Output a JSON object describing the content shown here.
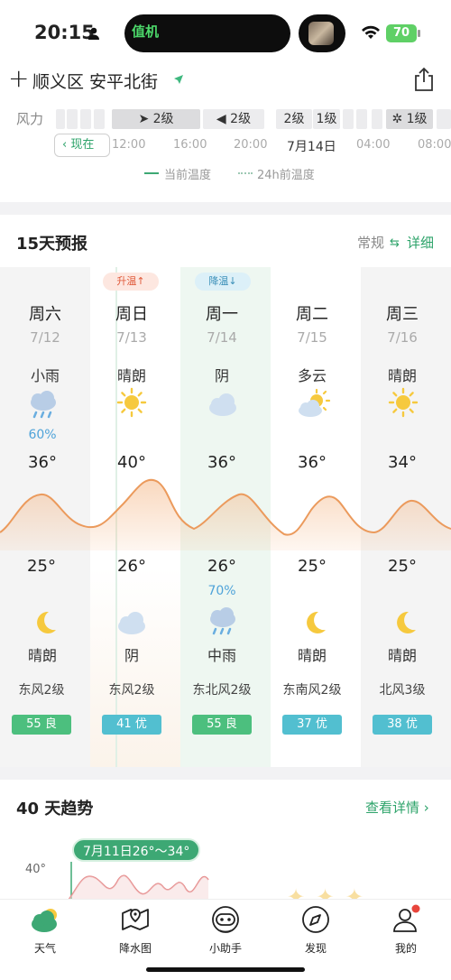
{
  "status_bar": {
    "time": "20:15",
    "island_app_text": "值机",
    "battery": "70"
  },
  "header": {
    "location": "顺义区 安平北街",
    "add_icon": "plus-icon",
    "share_icon": "share-icon"
  },
  "hourly": {
    "wind_label": "风力",
    "wind_cells": [
      "2级",
      "2级",
      "2级",
      "1级",
      "1级"
    ],
    "now_label": "现在",
    "hours": [
      "12:00",
      "16:00",
      "20:00",
      "7月14日",
      "04:00",
      "08:00"
    ],
    "legend_current": "当前温度",
    "legend_24h": "24h前温度"
  },
  "forecast15": {
    "title": "15天预报",
    "mode_normal": "常规",
    "mode_detail": "详细",
    "tag_up": "升温",
    "tag_down": "降温",
    "days": [
      {
        "weekday": "周六",
        "date": "7/12",
        "day_cond": "小雨",
        "day_icon": "rain-cloud-icon",
        "day_pop": "60%",
        "high": "36°",
        "low": "25°",
        "night_pop": "",
        "night_cond": "晴朗",
        "night_icon": "moon-icon",
        "wind": "东风2级",
        "aqi": "55 良",
        "aqi_color": "#4cbf7e"
      },
      {
        "weekday": "周日",
        "date": "7/13",
        "day_cond": "晴朗",
        "day_icon": "sun-icon",
        "day_pop": "",
        "high": "40°",
        "low": "26°",
        "night_pop": "",
        "night_cond": "阴",
        "night_icon": "cloud-icon",
        "wind": "东风2级",
        "aqi": "41 优",
        "aqi_color": "#52bfd0"
      },
      {
        "weekday": "周一",
        "date": "7/14",
        "day_cond": "阴",
        "day_icon": "cloud-icon",
        "day_pop": "",
        "high": "36°",
        "low": "26°",
        "night_pop": "70%",
        "night_cond": "中雨",
        "night_icon": "rain-cloud-icon",
        "wind": "东北风2级",
        "aqi": "55 良",
        "aqi_color": "#4cbf7e"
      },
      {
        "weekday": "周二",
        "date": "7/15",
        "day_cond": "多云",
        "day_icon": "partly-cloudy-icon",
        "day_pop": "",
        "high": "36°",
        "low": "25°",
        "night_pop": "",
        "night_cond": "晴朗",
        "night_icon": "moon-icon",
        "wind": "东南风2级",
        "aqi": "37 优",
        "aqi_color": "#52bfd0"
      },
      {
        "weekday": "周三",
        "date": "7/16",
        "day_cond": "晴朗",
        "day_icon": "sun-icon",
        "day_pop": "",
        "high": "34°",
        "low": "25°",
        "night_pop": "",
        "night_cond": "晴朗",
        "night_icon": "moon-icon",
        "wind": "北风3级",
        "aqi": "38 优",
        "aqi_color": "#52bfd0"
      }
    ]
  },
  "trend40": {
    "title": "40 天趋势",
    "view_detail": "查看详情",
    "tooltip": "7月11日26°～34°",
    "y_label": "40°"
  },
  "tabbar": {
    "tabs": [
      {
        "label": "天气",
        "icon": "weather-icon"
      },
      {
        "label": "降水图",
        "icon": "map-pin-icon"
      },
      {
        "label": "小助手",
        "icon": "robot-icon"
      },
      {
        "label": "发现",
        "icon": "compass-icon"
      },
      {
        "label": "我的",
        "icon": "user-icon"
      }
    ]
  }
}
